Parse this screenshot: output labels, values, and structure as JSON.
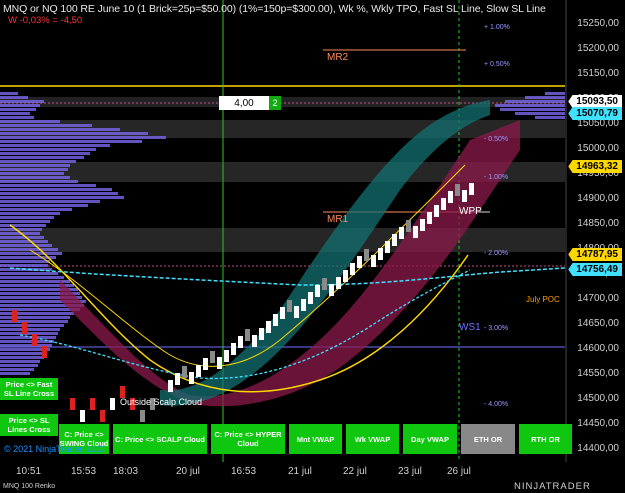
{
  "header": {
    "title": "MNQ or NQ 100 RE June 10 (1 Brick=25p=$50.00) (1%=150p=$300.00), Wk %, Wkly TPO, Fast SL Line, Slow SL Line",
    "subtitle": "W -0,03% = -4,50"
  },
  "y_axis": {
    "ticks": [
      "15250,00",
      "15200,00",
      "15150,00",
      "15100,00",
      "15050,00",
      "15000,00",
      "14950,00",
      "14900,00",
      "14850,00",
      "14800,00",
      "14750,00",
      "14700,00",
      "14650,00",
      "14600,00",
      "14550,00",
      "14500,00",
      "14450,00",
      "14400,00"
    ]
  },
  "x_axis": {
    "ticks": [
      "10:51",
      "15:53",
      "18:03",
      "20 jul",
      "16:53",
      "21 jul",
      "22 jul",
      "23 jul",
      "26 jul"
    ]
  },
  "price_tags": [
    {
      "label": "15093,50",
      "color": "#ffffff"
    },
    {
      "label": "15070,79",
      "color": "#40e0ff"
    },
    {
      "label": "14963,32",
      "color": "#ffd700"
    },
    {
      "label": "14787,95",
      "color": "#ffd700"
    },
    {
      "label": "14756,49",
      "color": "#40e0ff"
    }
  ],
  "levels": {
    "mr2": "MR2",
    "mr1": "MR1",
    "wpp": "WPP",
    "ws1": "WS1",
    "july_poc": "July POC"
  },
  "pct_labels": [
    "+ 1.00%",
    "+ 0.50%",
    "- 0.50%",
    "- 1.00%",
    "- 2.00%",
    "- 3.00%",
    "- 4.00%"
  ],
  "order_box": {
    "quantity": "4,00",
    "count": "2"
  },
  "cloud_label": "Outside Scalp Cloud",
  "side_buttons": [
    {
      "label": "Price <> Fast SL Line Cross"
    },
    {
      "label": "Price <> SL Lines Cross"
    }
  ],
  "bottom_buttons": [
    {
      "label": "C: Price <> SWING Cloud",
      "active": true
    },
    {
      "label": "C: Price <> SCALP Cloud",
      "active": true
    },
    {
      "label": "C: Price <> HYPER Cloud",
      "active": true
    },
    {
      "label": "Mnt VWAP",
      "active": true
    },
    {
      "label": "Wk VWAP",
      "active": true
    },
    {
      "label": "Day VWAP",
      "active": true
    },
    {
      "label": "ETH OR",
      "active": false
    },
    {
      "label": "RTH OR",
      "active": true
    }
  ],
  "copyright": "© 2021 NinjaTrader, LLC",
  "footer": "MNQ 100 Renko",
  "brand": "NINJATRADER",
  "colors": {
    "background": "#000000",
    "up_brick": "#ffffff",
    "down_brick": "#8a8a8a",
    "tpo": "#7b68ee",
    "green_button": "#0fc70f",
    "gray_button": "#888888",
    "vwap_cyan": "#40e0ff",
    "sl_yellow": "#ffd700"
  }
}
